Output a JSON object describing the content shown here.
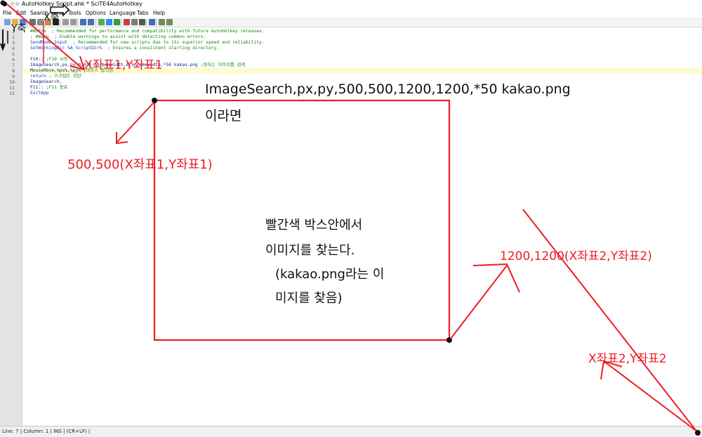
{
  "window": {
    "title": "☆☆ AutoHotkey Script.ahk * SciTE4AutoHotkey"
  },
  "menu": [
    {
      "label": "File"
    },
    {
      "label": "Edit"
    },
    {
      "label": "Search"
    },
    {
      "label": "View"
    },
    {
      "label": "Tools"
    },
    {
      "label": "Options"
    },
    {
      "label": "Language"
    },
    {
      "label": "Tabs"
    },
    {
      "label": "Help"
    }
  ],
  "toolbar": {
    "buttons": [
      {
        "name": "new-file-icon",
        "color": "#7aa0d8"
      },
      {
        "name": "open-folder-icon",
        "color": "#e2b33c"
      },
      {
        "name": "save-icon",
        "color": "#5b7fcf"
      },
      {
        "name": "cut-icon",
        "color": "#6e6e6e"
      },
      {
        "name": "copy-icon",
        "color": "#8a8a8a"
      },
      {
        "name": "paste-icon",
        "color": "#b98a4a"
      },
      {
        "name": "delete-icon",
        "color": "#222222"
      },
      {
        "name": "undo-icon",
        "color": "#9a9a9a"
      },
      {
        "name": "redo-icon",
        "color": "#9a9a9a"
      },
      {
        "name": "find-icon",
        "color": "#4a6fb0"
      },
      {
        "name": "replace-icon",
        "color": "#4a6fb0"
      },
      {
        "name": "compile-icon",
        "color": "#4caf50"
      },
      {
        "name": "run-icon",
        "color": "#2d8cf0"
      },
      {
        "name": "debug-icon",
        "color": "#3a9a3a"
      },
      {
        "name": "spy-icon",
        "color": "#c44040"
      },
      {
        "name": "settings-icon",
        "color": "#7a7a7a"
      },
      {
        "name": "window-icon",
        "color": "#555555"
      },
      {
        "name": "help-icon",
        "color": "#3b6fb6"
      },
      {
        "name": "list-icon",
        "color": "#6f8f4f"
      },
      {
        "name": "tools-icon",
        "color": "#6f8f4f"
      }
    ]
  },
  "editor": {
    "line_numbers": [
      "1",
      "2",
      "3",
      "4",
      "5",
      "6",
      "7",
      "8",
      "9",
      "10",
      "11",
      "12"
    ],
    "lines": [
      {
        "parts": [
          {
            "t": "#NoEnv  ; Recommended for performance and compatibility with future AutoHotkey releases.",
            "c": "c-green"
          }
        ]
      },
      {
        "parts": [
          {
            "t": "; #Warn  ; Enable warnings to assist with detecting common errors.",
            "c": "c-green"
          }
        ]
      },
      {
        "parts": [
          {
            "t": "SendMode Input  ",
            "c": "c-blue"
          },
          {
            "t": "; Recommended for new scripts due to its superior speed and reliability.",
            "c": "c-green"
          }
        ]
      },
      {
        "parts": [
          {
            "t": "SetWorkingDir %A_ScriptDir%  ",
            "c": "c-blue"
          },
          {
            "t": "; Ensures a consistent starting directory.",
            "c": "c-green"
          }
        ]
      },
      {
        "parts": []
      },
      {
        "parts": [
          {
            "t": "F10:: ",
            "c": "c-navy"
          },
          {
            "t": ";F10 시작",
            "c": "c-green"
          }
        ]
      },
      {
        "parts": [
          {
            "t": "ImageSearch,px,py,0,0,A_Screenwidth,A_Screenwidth,*50 kakao.png ",
            "c": "c-navy"
          },
          {
            "t": ";원하는 이미지를 검색",
            "c": "c-green"
          }
        ]
      },
      {
        "parts": [
          {
            "t": "MouseMove,%px%,%py% ",
            "c": "c-navy"
          },
          {
            "t": ";마우스 움직임",
            "c": "c-green"
          }
        ]
      },
      {
        "parts": [
          {
            "t": "return ",
            "c": "c-blue"
          },
          {
            "t": "; 스크립트 리턴",
            "c": "c-green"
          }
        ]
      },
      {
        "parts": [
          {
            "t": "ImageSearch,",
            "c": "c-navy"
          }
        ]
      },
      {
        "parts": [
          {
            "t": "F11:: ",
            "c": "c-navy"
          },
          {
            "t": ";F11 종료",
            "c": "c-green"
          }
        ]
      },
      {
        "parts": [
          {
            "t": "ExitApp",
            "c": "c-blue"
          }
        ]
      }
    ]
  },
  "statusbar": {
    "text": "Line: 7 | Column: 1 | INS | (CR+LF) |"
  },
  "annotations": {
    "y_axis_label": "Y축",
    "x_axis_label": "X축",
    "coord1_label": "X좌표1,Y좌표1",
    "example_line1": "ImageSearch,px,py,500,500,1200,1200,*50 kakao.png",
    "example_line2": "이라면",
    "point1_label": "500,500(X좌표1,Y좌표1)",
    "box_text": [
      "빨간색 박스안에서",
      "이미지를 찾는다.",
      "(kakao.png라는 이",
      "미지를 찾음)"
    ],
    "point2_label": "1200,1200(X좌표2,Y좌표2)",
    "coord2_label": "X좌표2,Y좌표2",
    "red": "#ee1c24"
  }
}
